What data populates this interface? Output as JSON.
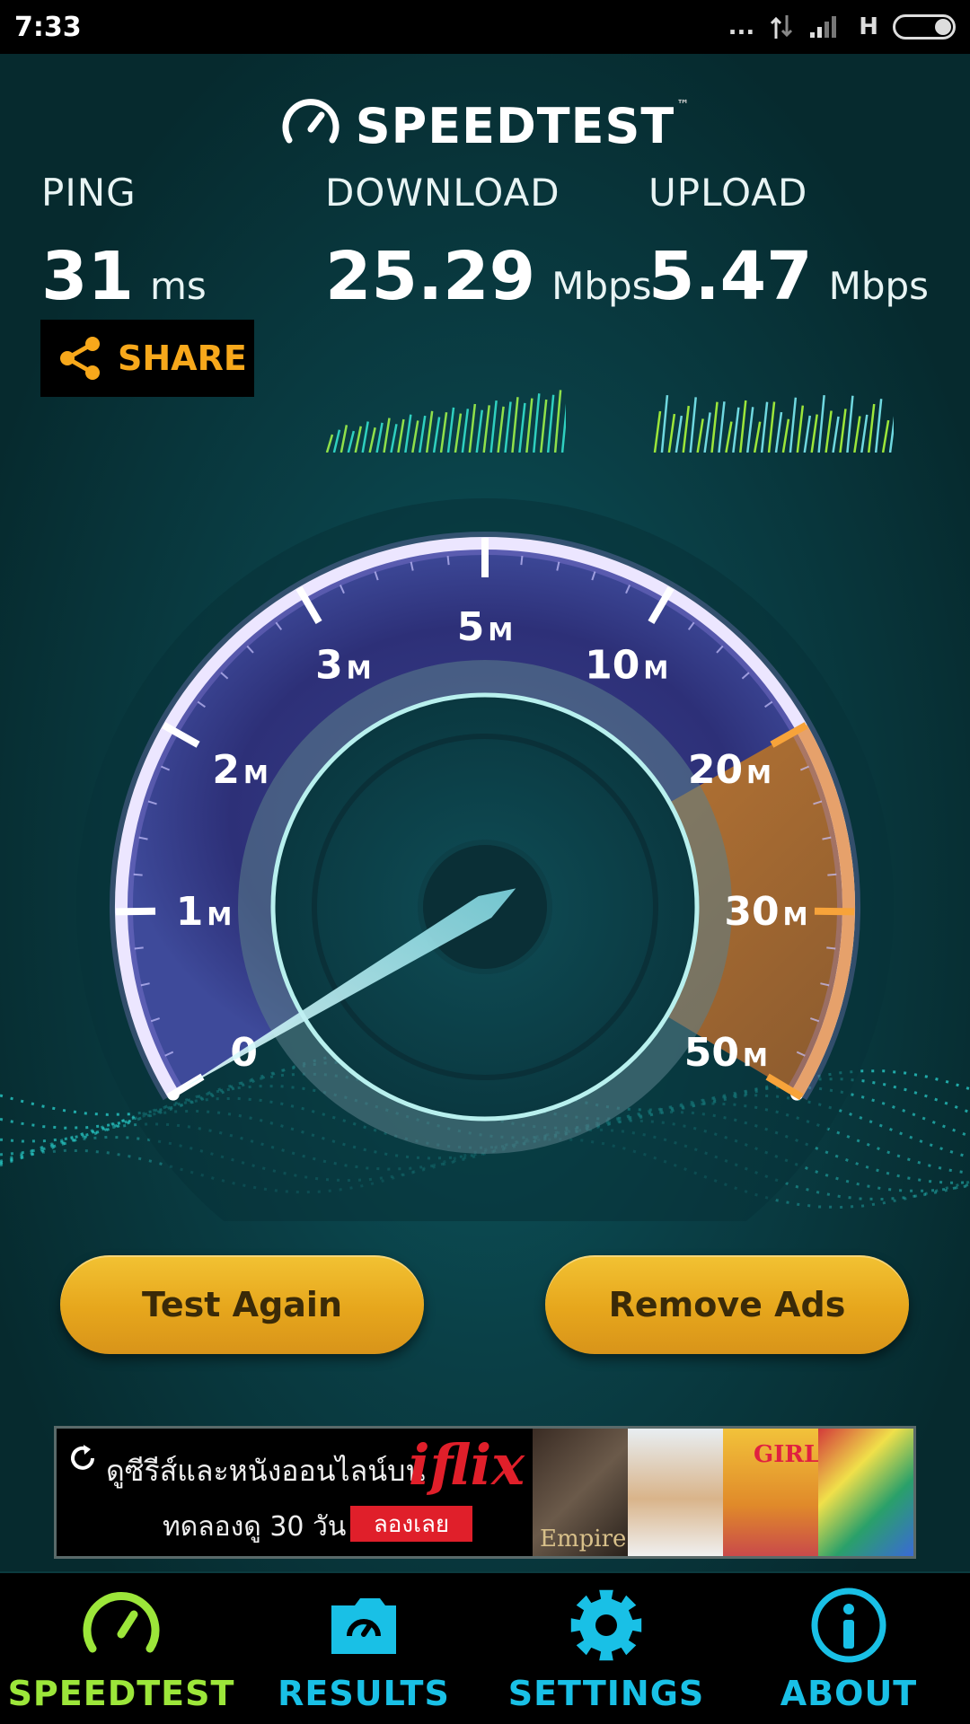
{
  "status_bar": {
    "time": "7:33",
    "signal_dots": "...",
    "network_type": "H"
  },
  "brand": {
    "name": "SPEEDTEST",
    "trademark": "™"
  },
  "metrics": {
    "ping": {
      "label": "PING",
      "value": "31",
      "unit": "ms"
    },
    "download": {
      "label": "DOWNLOAD",
      "value": "25.29",
      "unit": "Mbps"
    },
    "upload": {
      "label": "UPLOAD",
      "value": "5.47",
      "unit": "Mbps"
    }
  },
  "share": {
    "label": "SHARE",
    "icon": "share-icon"
  },
  "gauge": {
    "ticks": [
      {
        "num": "0",
        "unit": ""
      },
      {
        "num": "1",
        "unit": "M"
      },
      {
        "num": "2",
        "unit": "M"
      },
      {
        "num": "3",
        "unit": "M"
      },
      {
        "num": "5",
        "unit": "M"
      },
      {
        "num": "10",
        "unit": "M"
      },
      {
        "num": "20",
        "unit": "M"
      },
      {
        "num": "30",
        "unit": "M"
      },
      {
        "num": "50",
        "unit": "M"
      }
    ],
    "needle_fraction": 0.0
  },
  "buttons": {
    "test_again": "Test Again",
    "remove_ads": "Remove Ads"
  },
  "ad": {
    "line1": "ดูซีรีส์และหนังออนไลน์บน",
    "brand": "iflix",
    "line2": "ทดลองดู 30 วัน",
    "cta": "ลองเลย",
    "thumb1_label": "Empire",
    "thumb3_title": "GIRLS"
  },
  "tabs": [
    {
      "label": "SPEEDTEST",
      "icon": "speedometer-icon",
      "active": true
    },
    {
      "label": "RESULTS",
      "icon": "folder-icon",
      "active": false
    },
    {
      "label": "SETTINGS",
      "icon": "gear-icon",
      "active": false
    },
    {
      "label": "ABOUT",
      "icon": "info-icon",
      "active": false
    }
  ],
  "colors": {
    "accent_green": "#9ce63a",
    "accent_cyan": "#19c0e6",
    "accent_orange": "#f7a81b",
    "button_gold": "#e6a61c"
  }
}
